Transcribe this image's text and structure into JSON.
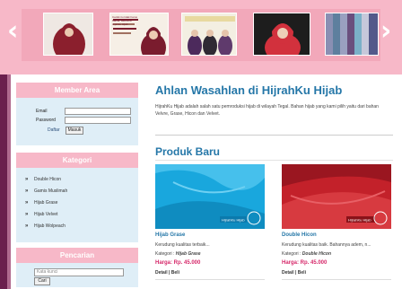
{
  "banner": {
    "slides": [
      {
        "name": "slide-1",
        "bg": "#efe8e3",
        "fg": "#8b1f2d"
      },
      {
        "name": "slide-2",
        "bg": "#f6efe6",
        "fg": "#7a1c2e",
        "caption": "Cantik itu tidak harus Mahal, Hemat di Hijabku Hijab"
      },
      {
        "name": "slide-3",
        "bg": "#f3efe2",
        "fg": "#4c2a5c"
      },
      {
        "name": "slide-4",
        "bg": "#1d1d1d",
        "fg": "#d2313d"
      },
      {
        "name": "slide-5",
        "bg": "#6c6f8d",
        "fg": "#c5c7d8"
      }
    ],
    "prev_icon": "chevron-left-icon",
    "next_icon": "chevron-right-icon"
  },
  "member": {
    "title": "Member Area",
    "email_label": "Email",
    "password_label": "Password",
    "email_value": "",
    "password_value": "",
    "daftar_label": "Daftar",
    "masuk_label": "Masuk"
  },
  "kategori": {
    "title": "Kategori",
    "items": [
      "Double Hicon",
      "Gamis Muslimah",
      "Hijab Grase",
      "Hijab Velvet",
      "Hijab Wolpeach"
    ]
  },
  "pencarian": {
    "title": "Pencarian",
    "placeholder": "Kata kunci",
    "button_label": "Cari"
  },
  "main": {
    "title": "Ahlan Wasahlan di HijrahKu Hijab",
    "intro": "HijrahKu Hijab adalah salah satu pemroduksi hijab di wilayah Tegal. Bahan hijab yang kami pilih yaitu dari bahan Velvre, Grase, Hicon dan Velvet.",
    "produk_title": "Produk Baru"
  },
  "products": [
    {
      "name": "Hijab Grase",
      "desc": "Kerudung kualitas terbaik...",
      "kategori_label": "Kategori :",
      "kategori_value": "Hijab Grase",
      "price": "Harga: Rp. 45.000",
      "detail": "Detail | Beli",
      "image_color": "#19a7dd",
      "badge": "HijrahKu Hijab"
    },
    {
      "name": "Double Hicon",
      "desc": "Kerudung kualitas baik. Bahannya adem, n...",
      "kategori_label": "Kategori :",
      "kategori_value": "Double Hicon",
      "price": "Harga: Rp. 45.000",
      "detail": "Detail | Beli",
      "image_color": "#c3212a",
      "badge": "HijrahKu Hijab"
    }
  ],
  "colors": {
    "banner": "#f7b8c8",
    "heading": "#2577a8",
    "price": "#d6286a",
    "sidebar_bg": "#dfeef7",
    "stripe": "#6b1f4d"
  }
}
